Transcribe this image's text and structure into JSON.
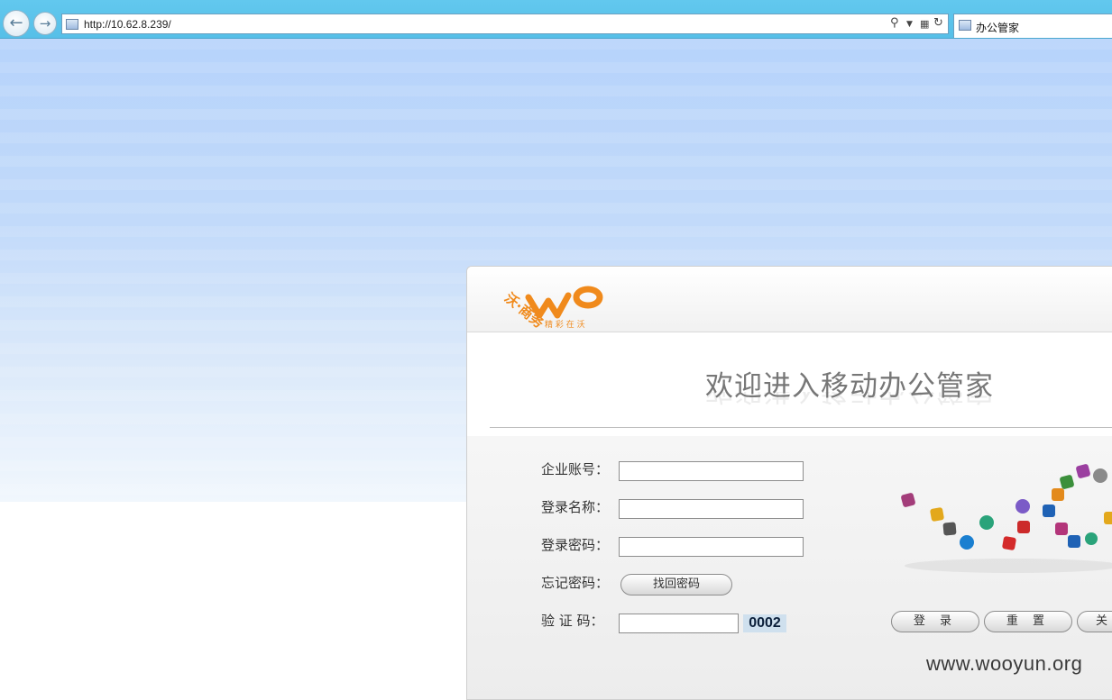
{
  "browser": {
    "url": "http://10.62.8.239/",
    "tab_title": "办公管家",
    "icons": [
      "back-arrow-icon",
      "forward-arrow-icon",
      "page-favicon-icon",
      "search-icon",
      "dropdown-icon",
      "compatibility-view-icon",
      "refresh-icon"
    ]
  },
  "logo": {
    "brand_text": "沃·商务",
    "slogan": "精 彩 在 沃",
    "colors": {
      "orange": "#f08a1c"
    }
  },
  "welcome": {
    "title": "欢迎进入移动办公管家"
  },
  "form": {
    "company_account_label": "企业账号：",
    "company_account_value": "",
    "login_name_label": "登录名称：",
    "login_name_value": "",
    "password_label": "登录密码：",
    "password_value": "",
    "forgot_label": "忘记密码：",
    "forgot_button": "找回密码",
    "captcha_label": "验 证 码：",
    "captcha_value": "",
    "captcha_code": "0002"
  },
  "buttons": {
    "login": "登 录",
    "reset": "重 置",
    "close_partial": "关"
  },
  "watermark": "www.wooyun.org",
  "colors": {
    "chrome_blue": "#5bc4eb",
    "page_bg_top": "#b6d3fb",
    "form_bg": "#efefef"
  }
}
